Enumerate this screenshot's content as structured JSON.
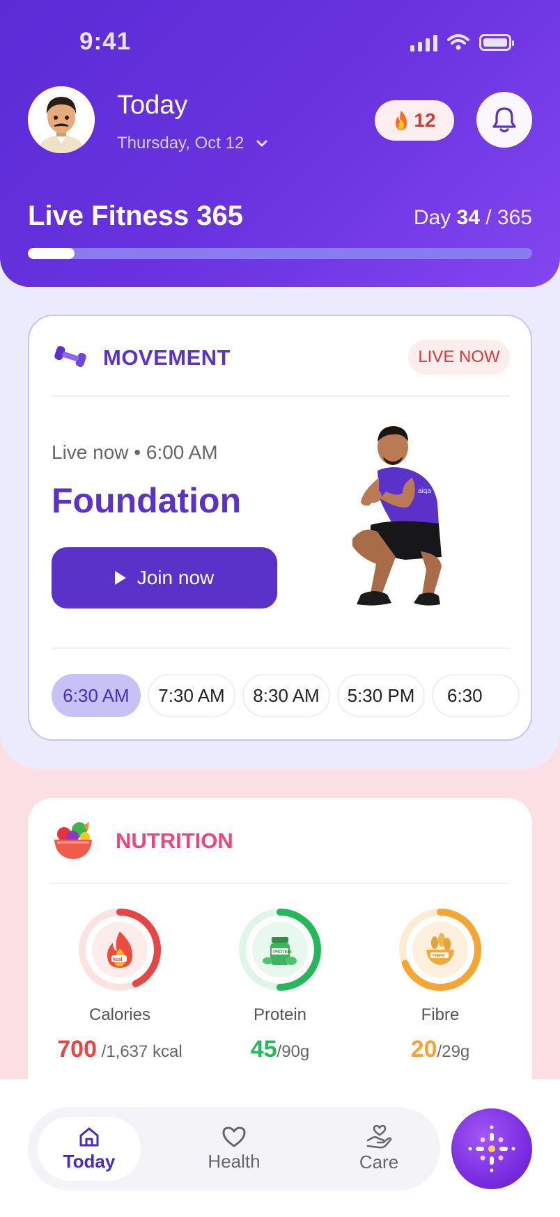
{
  "status_bar": {
    "time": "9:41"
  },
  "header": {
    "title": "Today",
    "date": "Thursday, Oct 12",
    "streak_count": "12",
    "program_name": "Live Fitness 365",
    "day_label": "Day",
    "day_current": "34",
    "day_total": "/ 365",
    "progress_fraction": 0.093
  },
  "movement": {
    "title": "MOVEMENT",
    "badge": "LIVE NOW",
    "subtitle": "Live now • 6:00 AM",
    "class_name": "Foundation",
    "join_label": "Join now",
    "slots": [
      "6:30 AM",
      "7:30 AM",
      "8:30 AM",
      "5:30 PM",
      "6:30"
    ],
    "active_slot_index": 0
  },
  "nutrition": {
    "title": "NUTRITION",
    "rings": [
      {
        "label": "Calories",
        "value": "700",
        "target": " /1,637 kcal",
        "progress": 0.43,
        "color": "#e84545",
        "track": "#fde2e2"
      },
      {
        "label": "Protein",
        "value": "45",
        "target": "/90g",
        "progress": 0.5,
        "color": "#25b85a",
        "track": "#dff6e6"
      },
      {
        "label": "Fibre",
        "value": "20",
        "target": "/29g",
        "progress": 0.69,
        "color": "#f5a632",
        "track": "#fdecd0"
      }
    ]
  },
  "nav": {
    "items": [
      {
        "label": "Today",
        "icon": "home-icon",
        "active": true
      },
      {
        "label": "Health",
        "icon": "heart-icon",
        "active": false
      },
      {
        "label": "Care",
        "icon": "care-hand-icon",
        "active": false
      }
    ],
    "fab_icon": "sparkle-dots-icon"
  },
  "colors": {
    "brand_purple": "#5a32c9",
    "header_gradient_start": "#5b2bd6",
    "header_gradient_end": "#8346f0",
    "live_red": "#d63a3a",
    "nutrition_pink": "#e8497a"
  }
}
